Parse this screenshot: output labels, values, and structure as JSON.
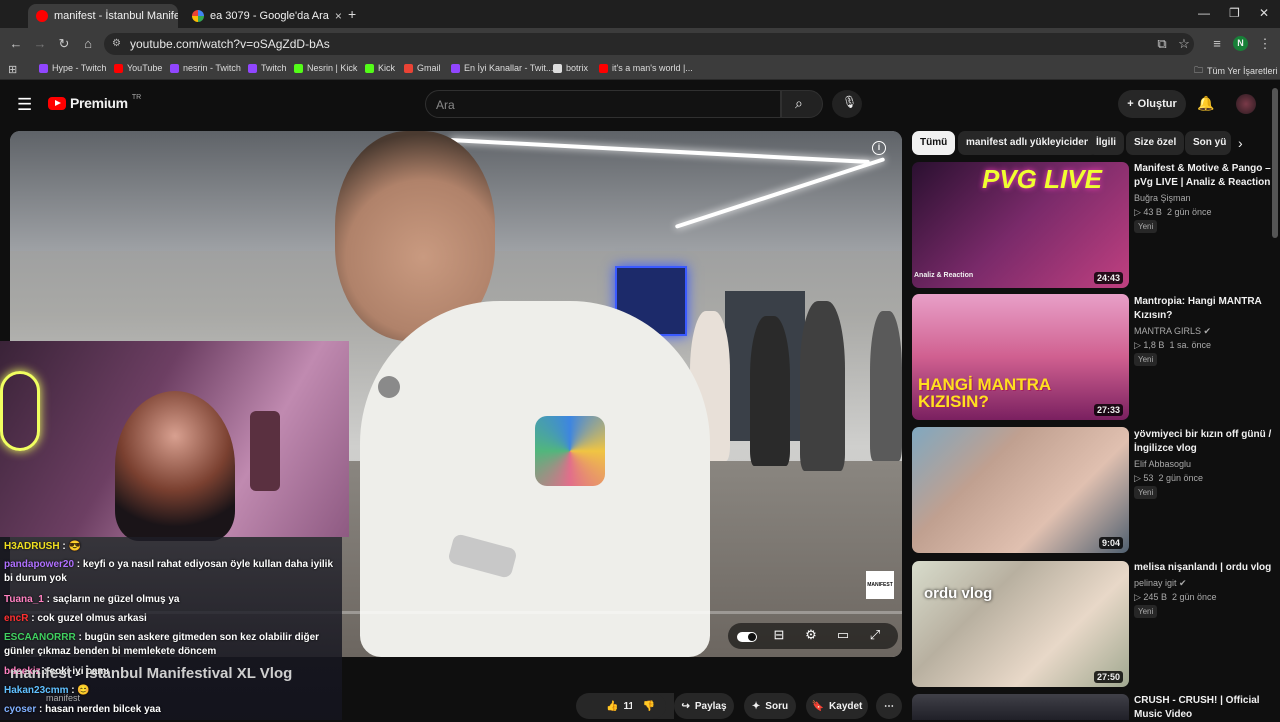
{
  "browser": {
    "tabs": [
      {
        "title": "manifest - İstanbul Manifes"
      },
      {
        "title": "ea 3079 - Google'da Ara"
      }
    ],
    "new_tab": "+",
    "window_controls": {
      "minimize": "—",
      "restore": "❐",
      "close": "✕"
    },
    "url": "youtube.com/watch?v=oSAgZdD-bAs",
    "profile_initial": "N",
    "bookmarks": [
      {
        "label": "Hype - Twitch",
        "color": "#9146ff"
      },
      {
        "label": "YouTube",
        "color": "#ff0000"
      },
      {
        "label": "nesrin - Twitch",
        "color": "#9146ff"
      },
      {
        "label": "Twitch",
        "color": "#9146ff"
      },
      {
        "label": "Nesrin | Kick",
        "color": "#53fc18"
      },
      {
        "label": "Kick",
        "color": "#53fc18"
      },
      {
        "label": "Gmail",
        "color": "#ea4335"
      },
      {
        "label": "En İyi Kanallar - Twit...",
        "color": "#9146ff"
      },
      {
        "label": "botrix",
        "color": "#dddddd"
      },
      {
        "label": "it's a man's world |...",
        "color": "#ff0000"
      }
    ],
    "all_bookmarks": "Tüm Yer İşaretleri"
  },
  "youtube": {
    "logo": "Premium",
    "logo_region": "TR",
    "search_placeholder": "Ara",
    "create_label": "Oluştur",
    "accent": "#ff0000"
  },
  "video": {
    "title": "manifest - İstanbul Manifestival XL Vlog",
    "channel_small": "manifest",
    "watermark": "MANIFEST",
    "actions": {
      "likes": "11 B",
      "share": "Paylaş",
      "ask": "Soru",
      "save": "Kaydet"
    }
  },
  "chat": [
    {
      "user": "H3ADRUSH",
      "text": "",
      "color": "#f0e020"
    },
    {
      "user": "pandapower20",
      "text": "keyfi o ya nasıl rahat ediyosan öyle kullan daha iyilik bi durum yok",
      "color": "#b070ff"
    },
    {
      "user": "Tuana_1",
      "text": "saçların ne güzel olmuş ya",
      "color": "#ff80c0"
    },
    {
      "user": "encR",
      "text": "cok guzel olmus arkasi",
      "color": "#ff3030"
    },
    {
      "user": "ESCAANORRR",
      "text": "bugün sen askere gitmeden son kez olabilir diğer günler çıkmaz benden bi memlekete döncem",
      "color": "#40d060"
    },
    {
      "user": "bdsekiz",
      "text": "coki iyi camı",
      "color": "#ff80c0"
    },
    {
      "user": "Hakan23cmm",
      "text": "",
      "color": "#60c0ff"
    },
    {
      "user": "cyoser",
      "text": "hasan nerden bilcek yaa",
      "color": "#80b0ff"
    }
  ],
  "filters": [
    "Tümü",
    "manifest adlı yükleyiciden",
    "İlgili",
    "Size özel",
    "Son yü"
  ],
  "recommendations": [
    {
      "title": "Manifest & Motive & Pango – pVg LIVE | Analiz & Reaction",
      "channel": "Buğra Şişman",
      "views": "43 B",
      "age": "2 gün önce",
      "badge": "Yeni",
      "duration": "24:43",
      "overlay": "PVG LIVE",
      "corner": "Analiz & Reaction",
      "verified": false
    },
    {
      "title": "Mantropia: Hangi MANTRA Kızısın?",
      "channel": "MANTRA GIRLS",
      "views": "1,8 B",
      "age": "1 sa. önce",
      "badge": "Yeni",
      "duration": "27:33",
      "overlay": "HANGİ MANTRA KIZISIN?",
      "corner": "",
      "verified": true
    },
    {
      "title": "yövmiyeci bir kızın off günü / İngilizce vlog",
      "channel": "Elif Abbasoglu",
      "views": "53",
      "age": "2 gün önce",
      "badge": "Yeni",
      "duration": "9:04",
      "overlay": "",
      "corner": "",
      "verified": false
    },
    {
      "title": "melisa nişanlandı | ordu vlog",
      "channel": "pelinay igit",
      "views": "245 B",
      "age": "2 gün önce",
      "badge": "Yeni",
      "duration": "27:50",
      "overlay": "ordu vlog",
      "corner": "",
      "verified": true
    },
    {
      "title": "CRUSH - CRUSH! | Official Music Video",
      "channel": "",
      "views": "",
      "age": "",
      "badge": "",
      "duration": "",
      "overlay": "",
      "corner": "",
      "verified": false
    }
  ]
}
